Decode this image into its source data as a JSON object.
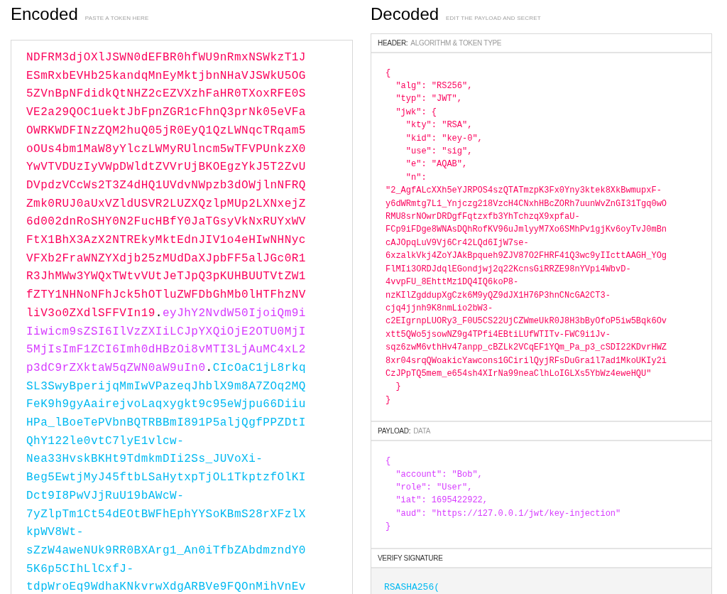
{
  "encoded": {
    "title": "Encoded",
    "subtitle": "PASTE A TOKEN HERE",
    "lines": [
      [
        {
          "kind": "header",
          "text": "NDFRM3djOXlJSWN0dEFBR0hfWU9nRmxNSWkzT1J"
        }
      ],
      [
        {
          "kind": "header",
          "text": "ESmRxbEVHb25kandqMnEyMktjbnNHaVJSWkU5OG"
        }
      ],
      [
        {
          "kind": "header",
          "text": "5ZVnBpNFdidkQtNHZ2cEZVXzhFaHR0TXoxRFE0S"
        }
      ],
      [
        {
          "kind": "header",
          "text": "VE2a29QOC1uektJbFpnZGR1cFhnQ3prNk05eVFa"
        }
      ],
      [
        {
          "kind": "header",
          "text": "OWRKWDFINzZQM2huQ05jR0EyQ1QzLWNqcTRqam5"
        }
      ],
      [
        {
          "kind": "header",
          "text": "oOUs4bm1MaW8yYlczLWMyRUlncm5wTFVPUnkzX0"
        }
      ],
      [
        {
          "kind": "header",
          "text": "YwVTVDUzIyVWpDWldtZVVrUjBKOEgzYkJ5T2ZvU"
        }
      ],
      [
        {
          "kind": "header",
          "text": "DVpdzVCcWs2T3Z4dHQ1UVdvNWpzb3dOWjlnNFRQ"
        }
      ],
      [
        {
          "kind": "header",
          "text": "Zmk0RUJ0aUxVZldUSVR2LUZXQzlpMUp2LXNxejZ"
        }
      ],
      [
        {
          "kind": "header",
          "text": "6d002dnRoSHY0N2FucHBfY0JaTGsyVkNxRUYxWV"
        }
      ],
      [
        {
          "kind": "header",
          "text": "FtX1BhX3AzX2NTREkyMktEdnJIV1o4eHIwNHNyc"
        }
      ],
      [
        {
          "kind": "header",
          "text": "VFXb2FraWNZYXdjb25zMUdDaXJpbFF5alJGc0R1"
        }
      ],
      [
        {
          "kind": "header",
          "text": "R3JhMWw3YWQxTWtvVUtJeTJpQ3pKUHBUUTVtZW1"
        }
      ],
      [
        {
          "kind": "header",
          "text": "fZTY1NHNoNFhJck5hOTluZWFDbGhMb0lHTFhzNV"
        }
      ],
      [
        {
          "kind": "header",
          "text": "liV3o0ZXdlSFFVIn19"
        },
        {
          "kind": "dot",
          "text": "."
        },
        {
          "kind": "payload",
          "text": "eyJhY2NvdW50IjoiQm9i"
        }
      ],
      [
        {
          "kind": "payload",
          "text": "Iiwicm9sZSI6IlVzZXIiLCJpYXQiOjE2OTU0MjI"
        }
      ],
      [
        {
          "kind": "payload",
          "text": "5MjIsImF1ZCI6Imh0dHBzOi8vMTI3LjAuMC4xL2"
        }
      ],
      [
        {
          "kind": "payload",
          "text": "p3dC9rZXktaW5qZWN0aW9uIn0"
        },
        {
          "kind": "dot",
          "text": "."
        },
        {
          "kind": "signature",
          "text": "CIcOaC1jL8rkq"
        }
      ],
      [
        {
          "kind": "signature",
          "text": "SL3SwyBperijqMmIwVPazeqJhblX9m8A7ZOq2MQ"
        }
      ],
      [
        {
          "kind": "signature",
          "text": "FeK9h9gyAairejvoLaqxygkt9c95eWjpu66Diiu"
        }
      ],
      [
        {
          "kind": "signature",
          "text": "HPa_lBoeTePVbnBQTRBBmI891P5aljQgfPPZDtI"
        }
      ],
      [
        {
          "kind": "signature",
          "text": "QhY122le0vtC7lyE1vlcw-"
        }
      ],
      [
        {
          "kind": "signature",
          "text": "Nea33HvskBKHt9TdmkmDIi2Ss_JUVoXi-"
        }
      ],
      [
        {
          "kind": "signature",
          "text": "Beg5EwtjMyJ45ftbLSaHytxpTjOL1TkptzfOlKI"
        }
      ],
      [
        {
          "kind": "signature",
          "text": "Dct9I8PwVJjRuU19bAWcW-"
        }
      ],
      [
        {
          "kind": "signature",
          "text": "7yZlpTm1Ct54dEOtBWFhEphYYSoKBmS28rXFzlX"
        }
      ],
      [
        {
          "kind": "signature",
          "text": "kpWV8Wt-"
        }
      ],
      [
        {
          "kind": "signature",
          "text": "sZzW4aweNUk9RR0BXArg1_An0iTfbZAbdmzndY0"
        }
      ],
      [
        {
          "kind": "signature",
          "text": "5K6p5CIhLlCxfJ-"
        }
      ],
      [
        {
          "kind": "signature",
          "text": "tdpWroEq9WdhaKNkvrwXdgARBVe9FQOnMihVnEv"
        }
      ]
    ]
  },
  "decoded": {
    "title": "Decoded",
    "subtitle": "EDIT THE PAYLOAD AND SECRET",
    "sections": [
      {
        "kind": "header",
        "label": "HEADER:",
        "sublabel": "ALGORITHM & TOKEN TYPE",
        "lines": [
          "{",
          "  \"alg\": \"RS256\",",
          "  \"typ\": \"JWT\",",
          "  \"jwk\": {",
          "    \"kty\": \"RSA\",",
          "    \"kid\": \"key-0\",",
          "    \"use\": \"sig\",",
          "    \"e\": \"AQAB\",",
          "    \"n\":",
          "\"2_AgfALcXXh5eYJRPOS4szQTATmzpK3Fx0Yny3ktek8XkBwmupxF-",
          "y6dWRmtg7L1_Ynjczg218VzcH4CNxhHBcZORh7uunWvZnGI31Tgq0wO",
          "RMU8srNOwrDRDgfFqtzxfb3YhTchzqX9xpfaU-",
          "FCp9iFDge8WNAsDQhRofKV96uJmlyyM7Xo6SMhPv1gjKv6oyTvJ0mBn",
          "cAJOpqLuV9Vj6Cr42LQd6IjW7se-",
          "6xzalkVkj4ZoYJAkBpqueh9ZJV87O2FHRF41Q3wc9yIIcttAAGH_YOg",
          "FlMIi3ORDJdqlEGondjwj2q22KcnsGiRRZE98nYVpi4WbvD-",
          "4vvpFU_8EhttMz1DQ4IQ6koP8-",
          "nzKIlZgddupXgCzk6M9yQZ9dJX1H76P3hnCNcGA2CT3-",
          "cjq4jjnh9K8nmLio2bW3-",
          "c2EIgrnpLUORy3_F0U5CS22UjCZWmeUkR0J8H3bByOfoP5iw5Bqk6Ov",
          "xtt5QWo5jsowNZ9g4TPfi4EBtiLUfWTITv-FWC9i1Jv-",
          "sqz6zwM6vthHv47anpp_cBZLk2VCqEF1YQm_Pa_p3_cSDI22KDvrHWZ",
          "8xr04srqQWoakicYawcons1GCirilQyjRFsDuGra1l7ad1MkoUKIy2i",
          "CzJPpTQ5mem_e654sh4XIrNa99neaClhLoIGLXs5YbWz4eweHQU\"",
          "  }",
          "}"
        ]
      },
      {
        "kind": "payload",
        "label": "PAYLOAD:",
        "sublabel": "DATA",
        "lines": [
          "{",
          "  \"account\": \"Bob\",",
          "  \"role\": \"User\",",
          "  \"iat\": 1695422922,",
          "  \"aud\": \"https://127.0.0.1/jwt/key-injection\"",
          "}"
        ]
      },
      {
        "kind": "verify",
        "label": "VERIFY SIGNATURE",
        "lines": [
          "RSASHA256("
        ]
      }
    ]
  }
}
